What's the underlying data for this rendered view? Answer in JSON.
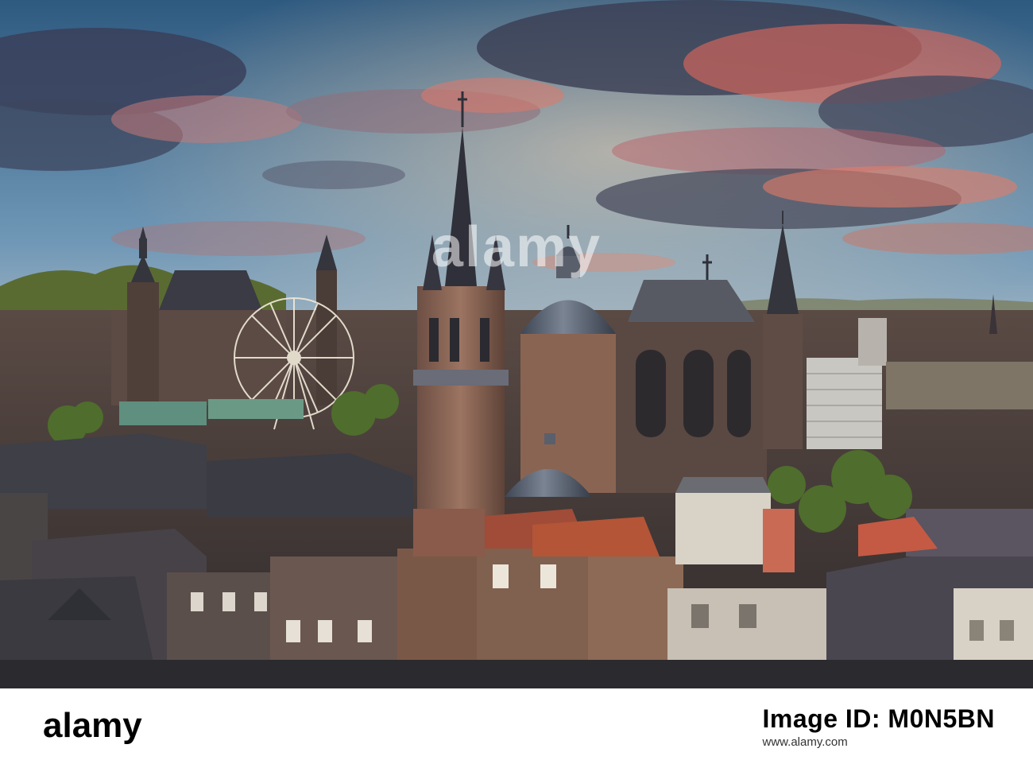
{
  "photo": {
    "subject": "aachen-cathedral-skyline-at-sunset",
    "colors": {
      "sky_top": "#3f6a8f",
      "sky_mid": "#7fa6c0",
      "sky_horizon": "#f2c7a1",
      "cloud_dark": "#3a3f52",
      "cloud_glow": "#e06a5b",
      "roof_slate": "#3b3c44",
      "brick": "#8a5a44",
      "copper_green": "#5f8f7e",
      "tree_green": "#4d6b2a"
    }
  },
  "watermark": {
    "text": "alamy"
  },
  "footer": {
    "logo_text": "alamy",
    "credit_label": "Image ID: M0N5BN",
    "id_prefix": "",
    "url": "www.alamy.com"
  }
}
